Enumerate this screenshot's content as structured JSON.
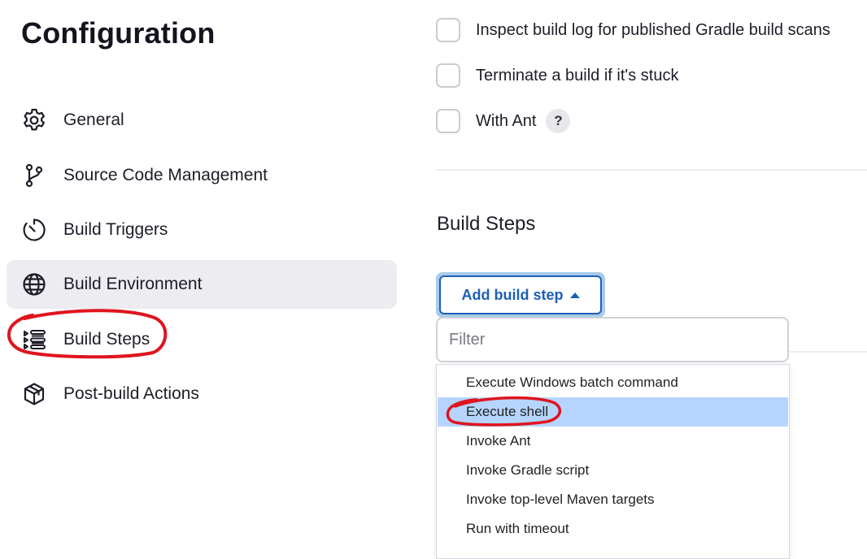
{
  "page": {
    "title": "Configuration"
  },
  "sidebar": {
    "items": [
      {
        "label": "General",
        "icon": "gear-icon"
      },
      {
        "label": "Source Code Management",
        "icon": "branch-icon"
      },
      {
        "label": "Build Triggers",
        "icon": "timer-icon"
      },
      {
        "label": "Build Environment",
        "icon": "globe-icon",
        "active": true
      },
      {
        "label": "Build Steps",
        "icon": "list-steps-icon"
      },
      {
        "label": "Post-build Actions",
        "icon": "package-icon"
      }
    ]
  },
  "options": [
    {
      "label": "Inspect build log for published Gradle build scans",
      "checked": false
    },
    {
      "label": "Terminate a build if it's stuck",
      "checked": false
    },
    {
      "label": "With Ant",
      "checked": false,
      "help": "?"
    }
  ],
  "build_steps": {
    "title": "Build Steps",
    "add_button_label": "Add build step",
    "filter_placeholder": "Filter",
    "menu_items": [
      "Execute Windows batch command",
      "Execute shell",
      "Invoke Ant",
      "Invoke Gradle script",
      "Invoke top-level Maven targets",
      "Run with timeout"
    ],
    "highlighted_item": "Execute shell"
  },
  "colors": {
    "accent": "#1d5fb8",
    "highlight": "#b5d5ff",
    "active_nav_bg": "#ececf1",
    "annotation": "#e0141e"
  }
}
